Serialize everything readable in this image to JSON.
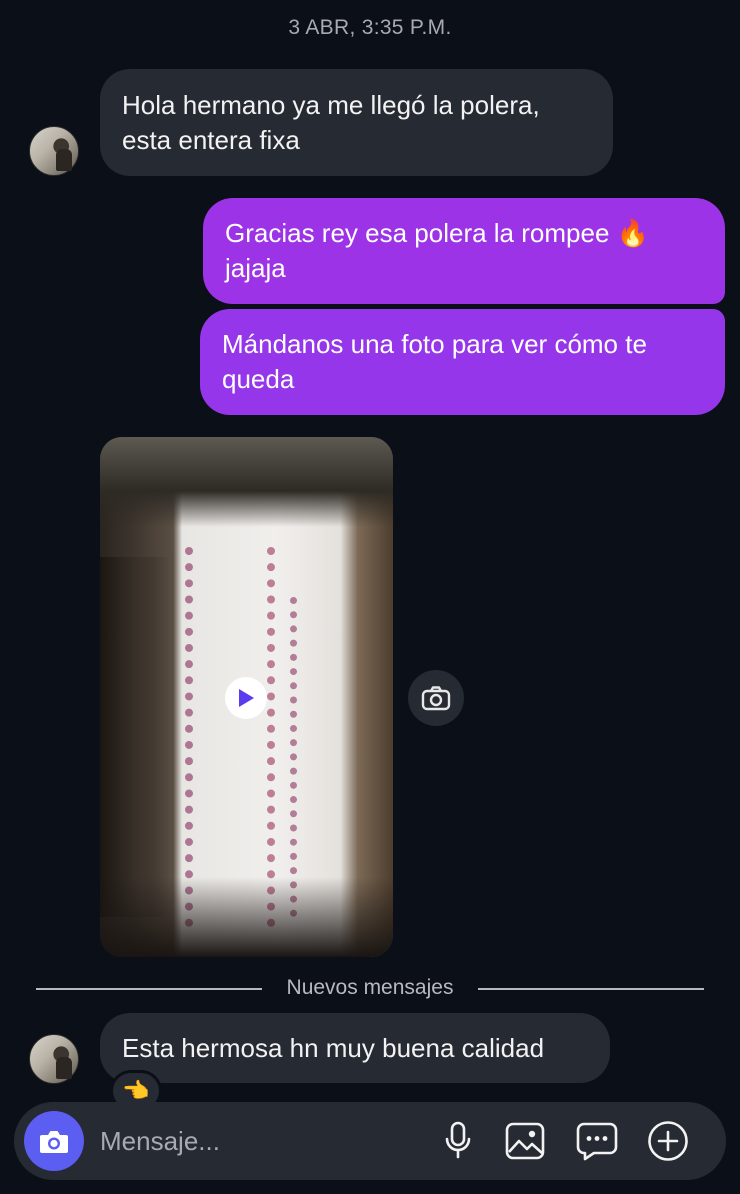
{
  "thread": {
    "timestamp": "3 ABR, 3:35 P.M."
  },
  "messages": [
    {
      "direction": "in",
      "text": "Hola hermano ya me llegó la polera, esta entera fixa"
    },
    {
      "direction": "out",
      "text": "Gracias rey esa polera la rompee 🔥 jajaja"
    },
    {
      "direction": "out",
      "text": "Mándanos una foto para ver cómo te queda"
    },
    {
      "direction": "in",
      "type": "video",
      "media_icon": "play-icon",
      "side_action_icon": "camera-icon"
    },
    {
      "direction": "in",
      "text": "Esta hermosa hn muy buena calidad",
      "reaction": "👈"
    }
  ],
  "divider": {
    "label": "Nuevos mensajes"
  },
  "composer": {
    "placeholder": "Mensaje...",
    "value": "",
    "icons": [
      "camera-icon",
      "microphone-icon",
      "gallery-icon",
      "sticker-icon",
      "plus-icon"
    ]
  },
  "colors": {
    "background": "#0b0f17",
    "incoming_bubble": "#262a33",
    "outgoing_bubble": "#9d33e6",
    "camera_button": "#5b5ef1"
  }
}
